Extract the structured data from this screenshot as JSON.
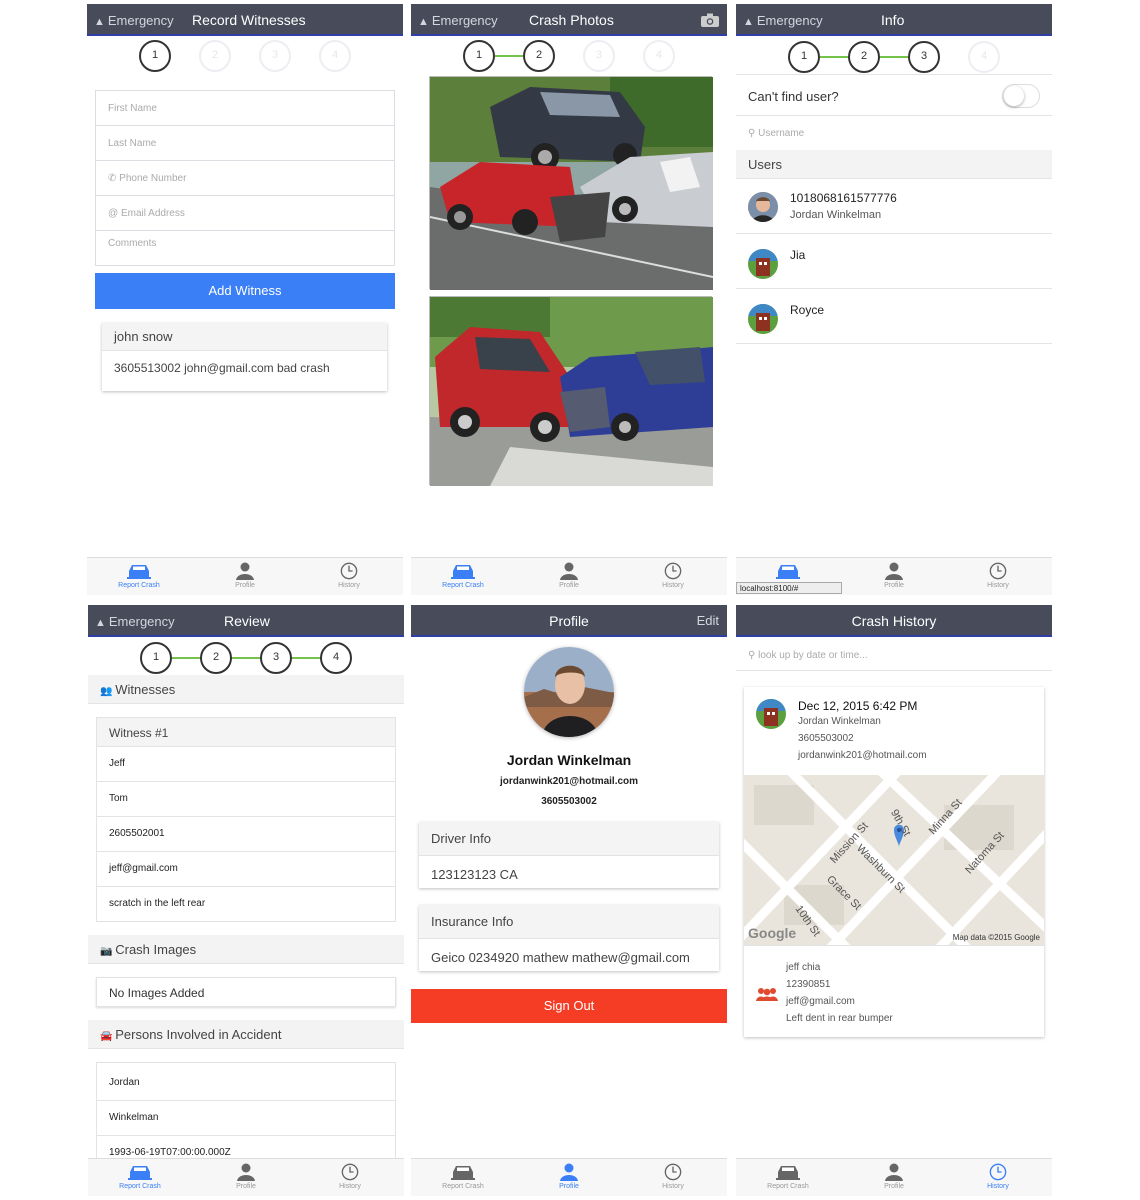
{
  "common": {
    "emergency": "Emergency",
    "tabs": {
      "report": "Report Crash",
      "profile": "Profile",
      "history": "History"
    },
    "accent": "#3a7ff5",
    "step_done_color": "#74c34b"
  },
  "s1": {
    "title": "Record Witnesses",
    "steps": [
      "1",
      "2",
      "3",
      "4"
    ],
    "placeholders": {
      "first": "First Name",
      "last": "Last Name",
      "phone": "Phone Number",
      "email": "Email Address",
      "comments": "Comments"
    },
    "add_button": "Add Witness",
    "witness": {
      "name": "john snow",
      "details": "3605513002 john@gmail.com bad crash"
    }
  },
  "s2": {
    "title": "Crash Photos",
    "steps": [
      "1",
      "2",
      "3",
      "4"
    ]
  },
  "s3": {
    "title": "Info",
    "steps": [
      "1",
      "2",
      "3",
      "4"
    ],
    "cant_find": "Can't find user?",
    "search_placeholder": "Username",
    "users_header": "Users",
    "users": [
      {
        "name": "1018068161577776",
        "sub": "Jordan Winkelman"
      },
      {
        "name": "Jia",
        "sub": ""
      },
      {
        "name": "Royce",
        "sub": ""
      }
    ],
    "url_tooltip": "localhost:8100/#"
  },
  "s4": {
    "title": "Review",
    "steps": [
      "1",
      "2",
      "3",
      "4"
    ],
    "witnesses_header": "Witnesses",
    "witness_title": "Witness #1",
    "witness_fields": [
      "Jeff",
      "Tom",
      "2605502001",
      "jeff@gmail.com",
      "scratch in the left rear"
    ],
    "images_header": "Crash Images",
    "no_images": "No Images Added",
    "persons_header": "Persons Involved in Accident",
    "person_fields": [
      "Jordan",
      "Winkelman",
      "1993-06-19T07:00:00.000Z"
    ]
  },
  "s5": {
    "title": "Profile",
    "edit": "Edit",
    "name": "Jordan Winkelman",
    "email": "jordanwink201@hotmail.com",
    "phone": "3605503002",
    "driver_header": "Driver Info",
    "driver_value": "123123123 CA",
    "insurance_header": "Insurance Info",
    "insurance_value": "Geico 0234920 mathew mathew@gmail.com",
    "sign_out": "Sign Out"
  },
  "s6": {
    "title": "Crash History",
    "search_placeholder": "look up by date or time...",
    "entry": {
      "date": "Dec 12, 2015 6:42 PM",
      "name": "Jordan Winkelman",
      "phone": "3605503002",
      "email": "jordanwink201@hotmail.com"
    },
    "map": {
      "streets": [
        "Mission St",
        "9th St",
        "Minna St",
        "Natoma St",
        "Washburn St",
        "Grace St",
        "10th St"
      ],
      "logo": "Google",
      "attribution": "Map data ©2015 Google"
    },
    "witness": {
      "name": "jeff chia",
      "phone": "12390851",
      "email": "jeff@gmail.com",
      "note": "Left dent in rear bumper"
    }
  }
}
